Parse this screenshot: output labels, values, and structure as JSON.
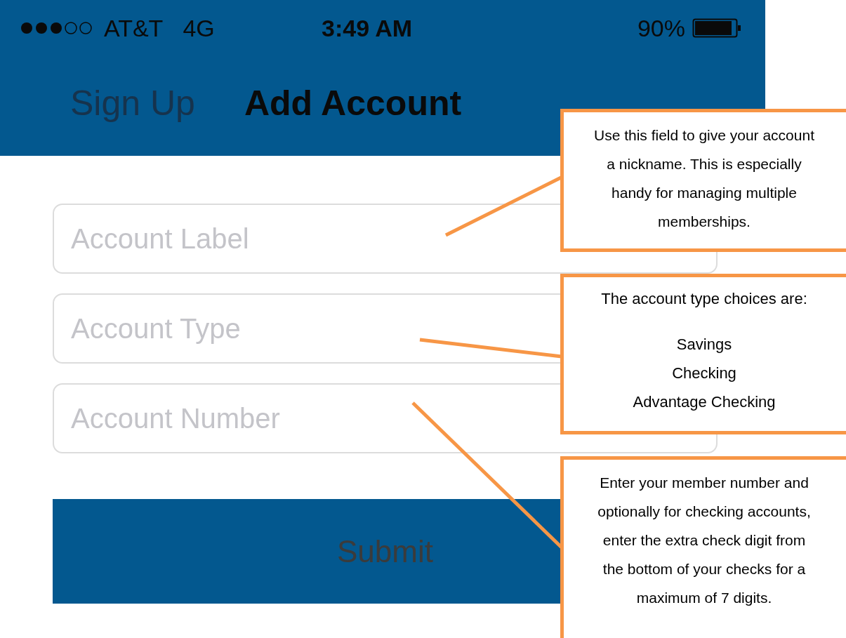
{
  "status_bar": {
    "carrier": "AT&T",
    "network": "4G",
    "time": "3:49 AM",
    "battery": "90%"
  },
  "nav_bar": {
    "back": "Sign Up",
    "title": "Add Account"
  },
  "form": {
    "fields": [
      {
        "placeholder": "Account Label"
      },
      {
        "placeholder": "Account Type"
      },
      {
        "placeholder": "Account Number"
      }
    ],
    "submit": "Submit"
  },
  "callouts": [
    {
      "kind": "paragraph",
      "text": "Use this field to give your account a nickname. This is especially handy for managing multiple memberships."
    },
    {
      "kind": "list",
      "text": "The account type choices are:",
      "items": [
        "Savings",
        "Checking",
        "Advantage Checking"
      ]
    },
    {
      "kind": "paragraph",
      "text": "Enter your member number and optionally for checking accounts, enter the extra check digit from the bottom of your checks for a maximum of 7 digits."
    }
  ]
}
